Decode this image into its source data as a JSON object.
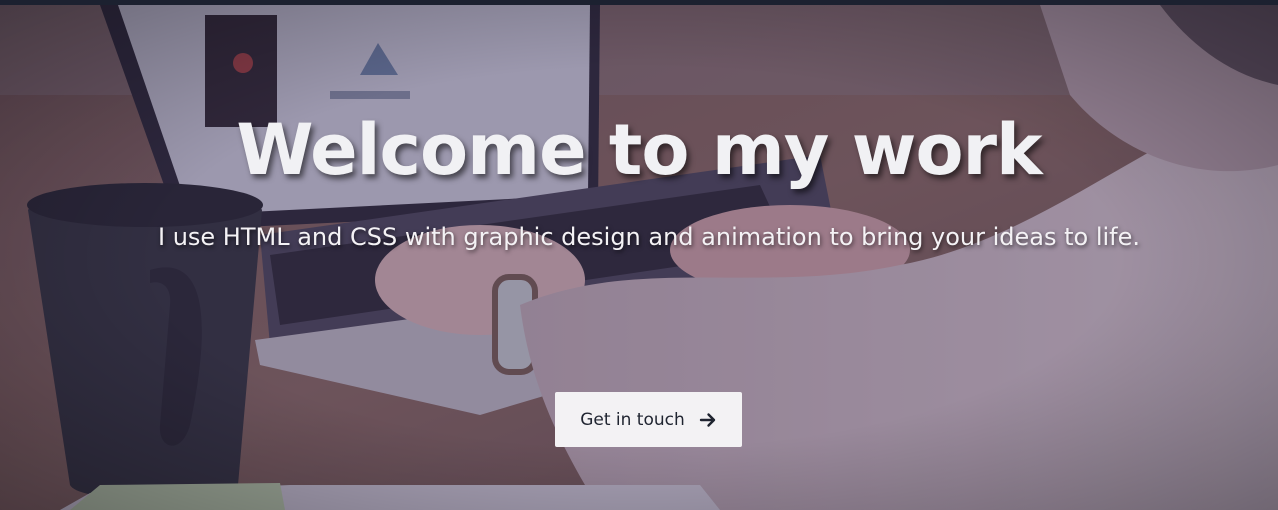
{
  "hero": {
    "title": "Welcome to my work",
    "subtitle": "I use HTML and CSS with graphic design and animation to bring your ideas to life.",
    "cta": {
      "label": "Get in touch",
      "icon": "arrow-right-icon"
    },
    "background_image": "photo of a person typing on a laptop beside a coffee mug"
  },
  "colors": {
    "top_strip": "#1c2130",
    "overlay_tint": "#3b2f5a",
    "text": "#f1f1f4",
    "button_bg": "#f3f2f4",
    "button_text": "#1f2430"
  }
}
